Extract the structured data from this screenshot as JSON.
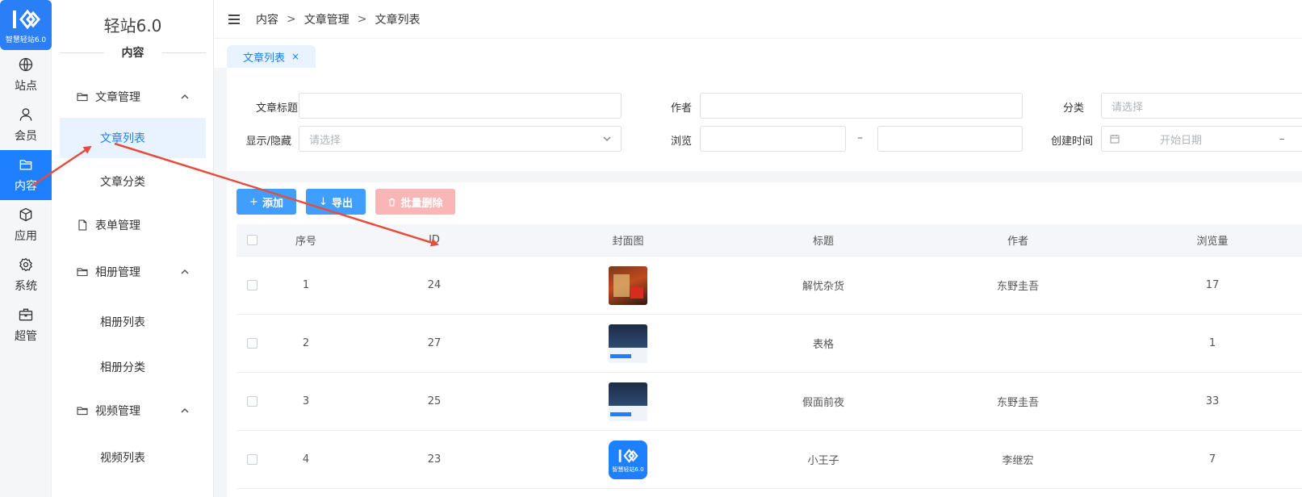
{
  "app": {
    "logo_text": "智慧轻站6.0",
    "title": "轻站6.0",
    "section": "内容"
  },
  "rail": [
    {
      "label": "站点",
      "icon": "globe-icon"
    },
    {
      "label": "会员",
      "icon": "user-icon"
    },
    {
      "label": "内容",
      "icon": "folder-icon",
      "active": true
    },
    {
      "label": "应用",
      "icon": "cube-icon"
    },
    {
      "label": "系统",
      "icon": "gear-icon"
    },
    {
      "label": "超管",
      "icon": "briefcase-icon"
    }
  ],
  "sidebar": {
    "groups": [
      {
        "label": "文章管理",
        "items": [
          "文章列表",
          "文章分类"
        ]
      },
      {
        "label": "表单管理",
        "items": []
      },
      {
        "label": "相册管理",
        "items": [
          "相册列表",
          "相册分类"
        ]
      },
      {
        "label": "视频管理",
        "items": [
          "视频列表"
        ]
      }
    ],
    "active_item": "文章列表"
  },
  "breadcrumb": [
    "内容",
    "文章管理",
    "文章列表"
  ],
  "breadcrumb_sep": ">",
  "tabs": [
    {
      "label": "文章列表",
      "close": "×"
    }
  ],
  "filters": {
    "title_label": "文章标题",
    "author_label": "作者",
    "category_label": "分类",
    "category_placeholder": "请选择",
    "visibility_label": "显示/隐藏",
    "visibility_placeholder": "请选择",
    "views_label": "浏览",
    "range_sep": "–",
    "created_label": "创建时间",
    "start_date_placeholder": "开始日期"
  },
  "toolbar": {
    "add": "添加",
    "export": "导出",
    "batch_delete": "批量删除"
  },
  "table": {
    "headers": [
      "序号",
      "ID",
      "封面图",
      "标题",
      "作者",
      "浏览量"
    ],
    "rows": [
      {
        "index": "1",
        "id": "24",
        "cover": "cover-a",
        "title": "解忧杂货",
        "author": "东野圭吾",
        "views": "17"
      },
      {
        "index": "2",
        "id": "27",
        "cover": "cover-b",
        "title": "表格",
        "author": "",
        "views": "1"
      },
      {
        "index": "3",
        "id": "25",
        "cover": "cover-b",
        "title": "假面前夜",
        "author": "东野圭吾",
        "views": "33"
      },
      {
        "index": "4",
        "id": "23",
        "cover": "cover-c",
        "title": "小王子",
        "author": "李继宏",
        "views": "7"
      }
    ]
  },
  "colors": {
    "primary": "#1e80ff",
    "button": "#409eff",
    "danger_light": "#fab6b6",
    "annotation": "#e74c3c"
  }
}
